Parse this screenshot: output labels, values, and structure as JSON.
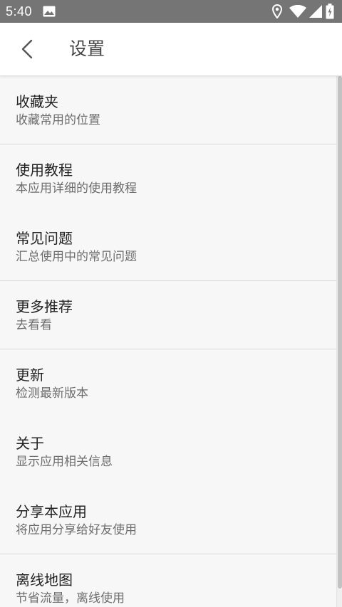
{
  "status_bar": {
    "time": "5:40",
    "icons": [
      "image-icon",
      "location-icon",
      "wifi-icon",
      "signal-icon",
      "battery-icon"
    ]
  },
  "toolbar": {
    "back_icon": "chevron-left-icon",
    "title": "设置"
  },
  "settings": {
    "items": [
      {
        "title": "收藏夹",
        "subtitle": "收藏常用的位置"
      },
      {
        "title": "使用教程",
        "subtitle": "本应用详细的使用教程"
      },
      {
        "title": "常见问题",
        "subtitle": "汇总使用中的常见问题"
      },
      {
        "title": "更多推荐",
        "subtitle": "去看看"
      },
      {
        "title": "更新",
        "subtitle": "检测最新版本"
      },
      {
        "title": "关于",
        "subtitle": "显示应用相关信息"
      },
      {
        "title": "分享本应用",
        "subtitle": "将应用分享给好友使用"
      },
      {
        "title": "离线地图",
        "subtitle": "节省流量，离线使用"
      }
    ]
  },
  "colors": {
    "status_bar": "#757575",
    "toolbar": "#ffffff",
    "background": "#f7f7f7",
    "title_text": "#222222",
    "subtitle_text": "#6e6e6e",
    "divider": "#d9d9d9"
  }
}
